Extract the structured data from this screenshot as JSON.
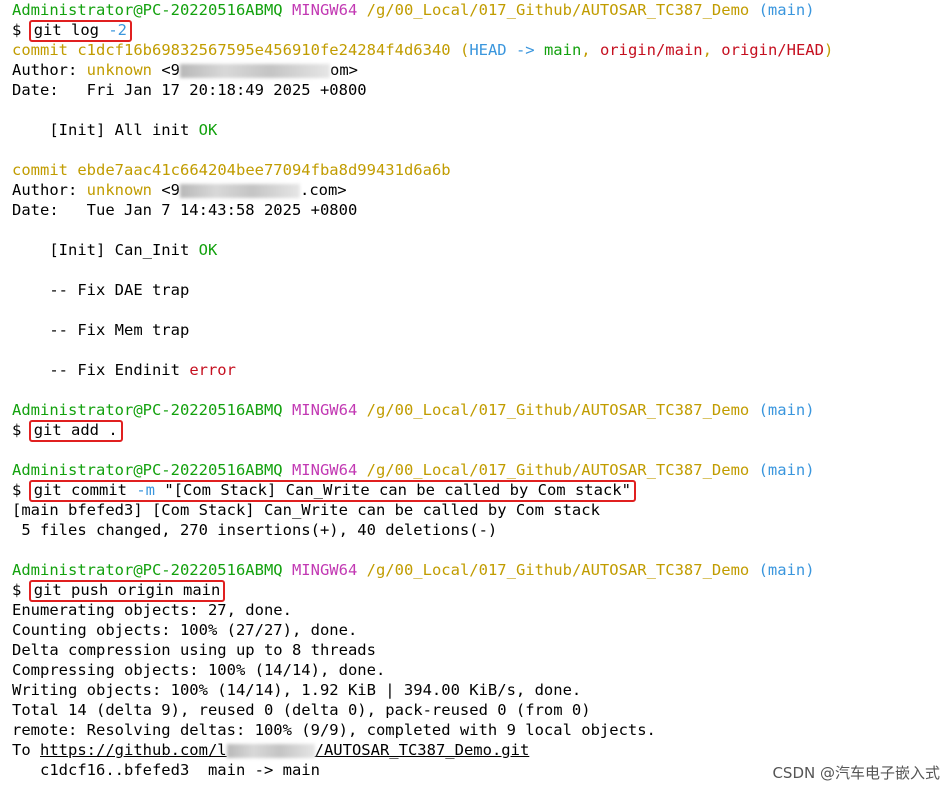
{
  "prompt": {
    "user_host": "Administrator@PC-20220516ABMQ",
    "system": "MINGW64",
    "path": "/g/00_Local/017_Github/AUTOSAR_TC387_Demo",
    "branch": "(main)",
    "dollar": "$"
  },
  "cmd1": {
    "text": "git log ",
    "flag": "-2"
  },
  "commit1": {
    "label": "commit",
    "hash": "c1dcf16b69832567595e456910fe24284f4d6340",
    "refs_open": "(",
    "head": "HEAD -> ",
    "main": "main",
    "sep1": ", ",
    "origin_main": "origin/main",
    "sep2": ", ",
    "origin_head": "origin/HEAD",
    "refs_close": ")",
    "author_label": "Author: ",
    "author_name": "unknown",
    "email_start": " <9",
    "email_end": "om>",
    "date_label": "Date:   ",
    "date": "Fri Jan 17 20:18:49 2025 +0800",
    "msg_text": "    [Init] All init ",
    "msg_ok": "OK"
  },
  "commit2": {
    "label": "commit",
    "hash": "ebde7aac41c664204bee77094fba8d99431d6a6b",
    "author_label": "Author: ",
    "author_name": "unknown",
    "email_start": " <9",
    "email_end": ".com>",
    "date_label": "Date:   ",
    "date": "Tue Jan 7 14:43:58 2025 +0800",
    "msg1_text": "    [Init] Can_Init ",
    "msg1_ok": "OK",
    "msg2": "    -- Fix DAE trap",
    "msg3": "    -- Fix Mem trap",
    "msg4_text": "    -- Fix Endinit ",
    "msg4_err": "error"
  },
  "cmd2": {
    "text": "git add ."
  },
  "cmd3": {
    "text": "git commit ",
    "flag": "-m",
    "arg": " \"[Com Stack] Can_Write can be called by Com stack\""
  },
  "commit_out": {
    "line1": "[main bfefed3] [Com Stack] Can_Write can be called by Com stack",
    "line2": " 5 files changed, 270 insertions(+), 40 deletions(-)"
  },
  "cmd4": {
    "text": "git push origin main"
  },
  "push_out": {
    "l1": "Enumerating objects: 27, done.",
    "l2": "Counting objects: 100% (27/27), done.",
    "l3": "Delta compression using up to 8 threads",
    "l4": "Compressing objects: 100% (14/14), done.",
    "l5": "Writing objects: 100% (14/14), 1.92 KiB | 394.00 KiB/s, done.",
    "l6": "Total 14 (delta 9), reused 0 (delta 0), pack-reused 0 (from 0)",
    "l7": "remote: Resolving deltas: 100% (9/9), completed with 9 local objects.",
    "to_label": "To ",
    "url_start": "https://github.com/l",
    "url_end": "/AUTOSAR_TC387_Demo.git",
    "l9": "   c1dcf16..bfefed3  main -> main"
  },
  "watermark": "CSDN @汽车电子嵌入式",
  "colors": {
    "prompt_green": "#13a10e",
    "mingw_magenta": "#c239b3",
    "commit_yellow": "#c19c00",
    "branch_cyan": "#3a96dd",
    "highlight_red": "#e02020"
  }
}
